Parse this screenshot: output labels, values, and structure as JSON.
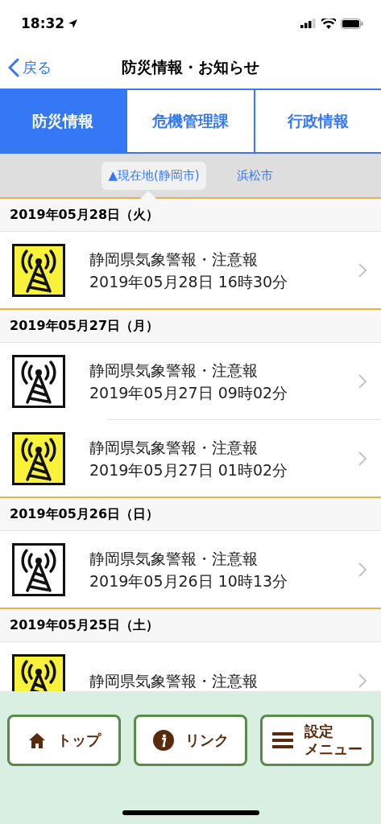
{
  "status_bar": {
    "time": "18:32"
  },
  "nav": {
    "back": "戻る",
    "title": "防災情報・お知らせ"
  },
  "tabs": [
    {
      "label": "防災情報",
      "selected": true
    },
    {
      "label": "危機管理課",
      "selected": false
    },
    {
      "label": "行政情報",
      "selected": false
    }
  ],
  "areas": [
    {
      "label": "▲現在地(静岡市)",
      "selected": true
    },
    {
      "label": "浜松市",
      "selected": false
    }
  ],
  "sections": [
    {
      "date": "2019年05月28日（火）",
      "items": [
        {
          "title": "静岡県気象警報・注意報",
          "time": "2019年05月28日 16時30分",
          "color": "#f8f23a"
        }
      ]
    },
    {
      "date": "2019年05月27日（月）",
      "items": [
        {
          "title": "静岡県気象警報・注意報",
          "time": "2019年05月27日 09時02分",
          "color": "#ffffff"
        },
        {
          "title": "静岡県気象警報・注意報",
          "time": "2019年05月27日 01時02分",
          "color": "#f8f23a"
        }
      ]
    },
    {
      "date": "2019年05月26日（日）",
      "items": [
        {
          "title": "静岡県気象警報・注意報",
          "time": "2019年05月26日 10時13分",
          "color": "#ffffff"
        }
      ]
    },
    {
      "date": "2019年05月25日（土）",
      "items": [
        {
          "title": "静岡県気象警報・注意報",
          "color": "#f8f23a"
        }
      ]
    }
  ],
  "bottom_buttons": [
    {
      "kind": "home",
      "label": "トップ"
    },
    {
      "kind": "info",
      "label": "リンク"
    },
    {
      "kind": "menu",
      "label_lines": [
        "設定",
        "メニュー"
      ]
    }
  ]
}
